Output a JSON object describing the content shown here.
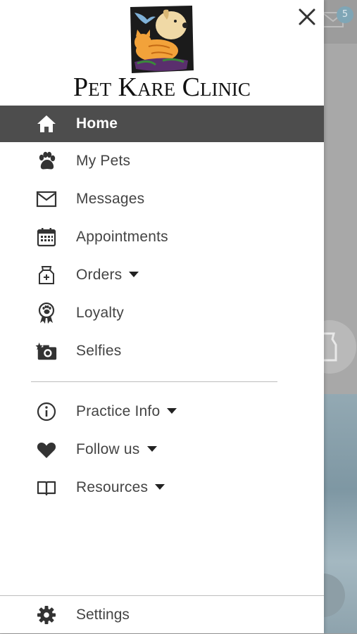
{
  "app": {
    "title": "Pet Kare Clinic",
    "logo_alt": "Pet Kare Clinic logo"
  },
  "background": {
    "mail_badge_count": "5"
  },
  "drawer": {
    "close_label": "Close",
    "menu_primary": [
      {
        "label": "Home",
        "icon": "home-icon",
        "active": true,
        "has_caret": false
      },
      {
        "label": "My Pets",
        "icon": "paw-icon",
        "active": false,
        "has_caret": false
      },
      {
        "label": "Messages",
        "icon": "envelope-icon",
        "active": false,
        "has_caret": false
      },
      {
        "label": "Appointments",
        "icon": "calendar-icon",
        "active": false,
        "has_caret": false
      },
      {
        "label": "Orders",
        "icon": "food-bag-icon",
        "active": false,
        "has_caret": true
      },
      {
        "label": "Loyalty",
        "icon": "award-ribbon-icon",
        "active": false,
        "has_caret": false
      },
      {
        "label": "Selfies",
        "icon": "camera-icon",
        "active": false,
        "has_caret": false
      }
    ],
    "menu_secondary": [
      {
        "label": "Practice Info",
        "icon": "info-icon",
        "has_caret": true
      },
      {
        "label": "Follow us",
        "icon": "heart-icon",
        "has_caret": true
      },
      {
        "label": "Resources",
        "icon": "book-icon",
        "has_caret": true
      }
    ],
    "settings_label": "Settings"
  },
  "colors": {
    "active_bg": "#4d4d4d",
    "text": "#444444",
    "overlay": "#a8a8a8"
  }
}
